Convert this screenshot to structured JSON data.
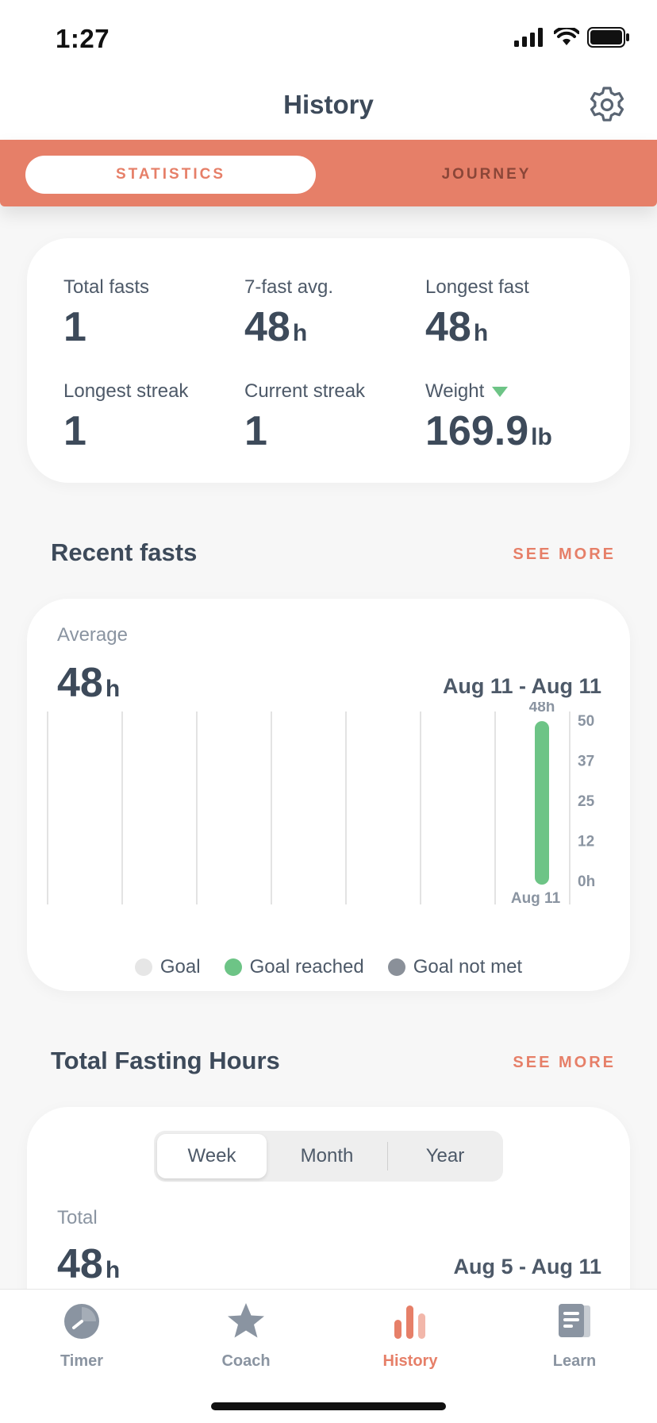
{
  "status": {
    "time": "1:27"
  },
  "header": {
    "title": "History",
    "settings_icon": "gear-icon"
  },
  "segments": {
    "active": "STATISTICS",
    "inactive": "JOURNEY"
  },
  "stats": {
    "total_fasts": {
      "label": "Total fasts",
      "value": "1"
    },
    "avg": {
      "label": "7-fast avg.",
      "value": "48",
      "unit": "h"
    },
    "longest_fast": {
      "label": "Longest fast",
      "value": "48",
      "unit": "h"
    },
    "longest_streak": {
      "label": "Longest streak",
      "value": "1"
    },
    "current_streak": {
      "label": "Current streak",
      "value": "1"
    },
    "weight": {
      "label": "Weight",
      "value": "169.9",
      "unit": "lb",
      "trend_icon": "triangle-down-icon",
      "trend_color": "#6dc486"
    }
  },
  "recent": {
    "title": "Recent fasts",
    "see_more": "SEE MORE",
    "average_label": "Average",
    "average_value": "48",
    "average_unit": "h",
    "range": "Aug 11 - Aug 11",
    "legend": {
      "goal": "Goal",
      "goal_reached": "Goal reached",
      "goal_not_met": "Goal not met"
    }
  },
  "chart_data": {
    "type": "bar",
    "categories": [
      "",
      "",
      "",
      "",
      "",
      "",
      "Aug 11"
    ],
    "values": [
      0,
      0,
      0,
      0,
      0,
      0,
      48
    ],
    "value_labels": [
      "",
      "",
      "",
      "",
      "",
      "",
      "48h"
    ],
    "yticks": [
      "50",
      "37",
      "25",
      "12",
      "0h"
    ],
    "ylim": [
      0,
      50
    ],
    "colors": {
      "goal": "#e6e6e6",
      "goal_reached": "#6dc486",
      "goal_not_met": "#8a9099"
    }
  },
  "total_hours": {
    "title": "Total Fasting Hours",
    "see_more": "SEE MORE",
    "tabs": [
      "Week",
      "Month",
      "Year"
    ],
    "active_tab": "Week",
    "total_label": "Total",
    "total_value": "48",
    "total_unit": "h",
    "range": "Aug 5 - Aug 11"
  },
  "tabbar": {
    "items": [
      {
        "label": "Timer",
        "icon": "timer-icon"
      },
      {
        "label": "Coach",
        "icon": "star-icon"
      },
      {
        "label": "History",
        "icon": "bar-chart-icon"
      },
      {
        "label": "Learn",
        "icon": "document-icon"
      }
    ],
    "active": "History",
    "accent": "#e67f68"
  }
}
